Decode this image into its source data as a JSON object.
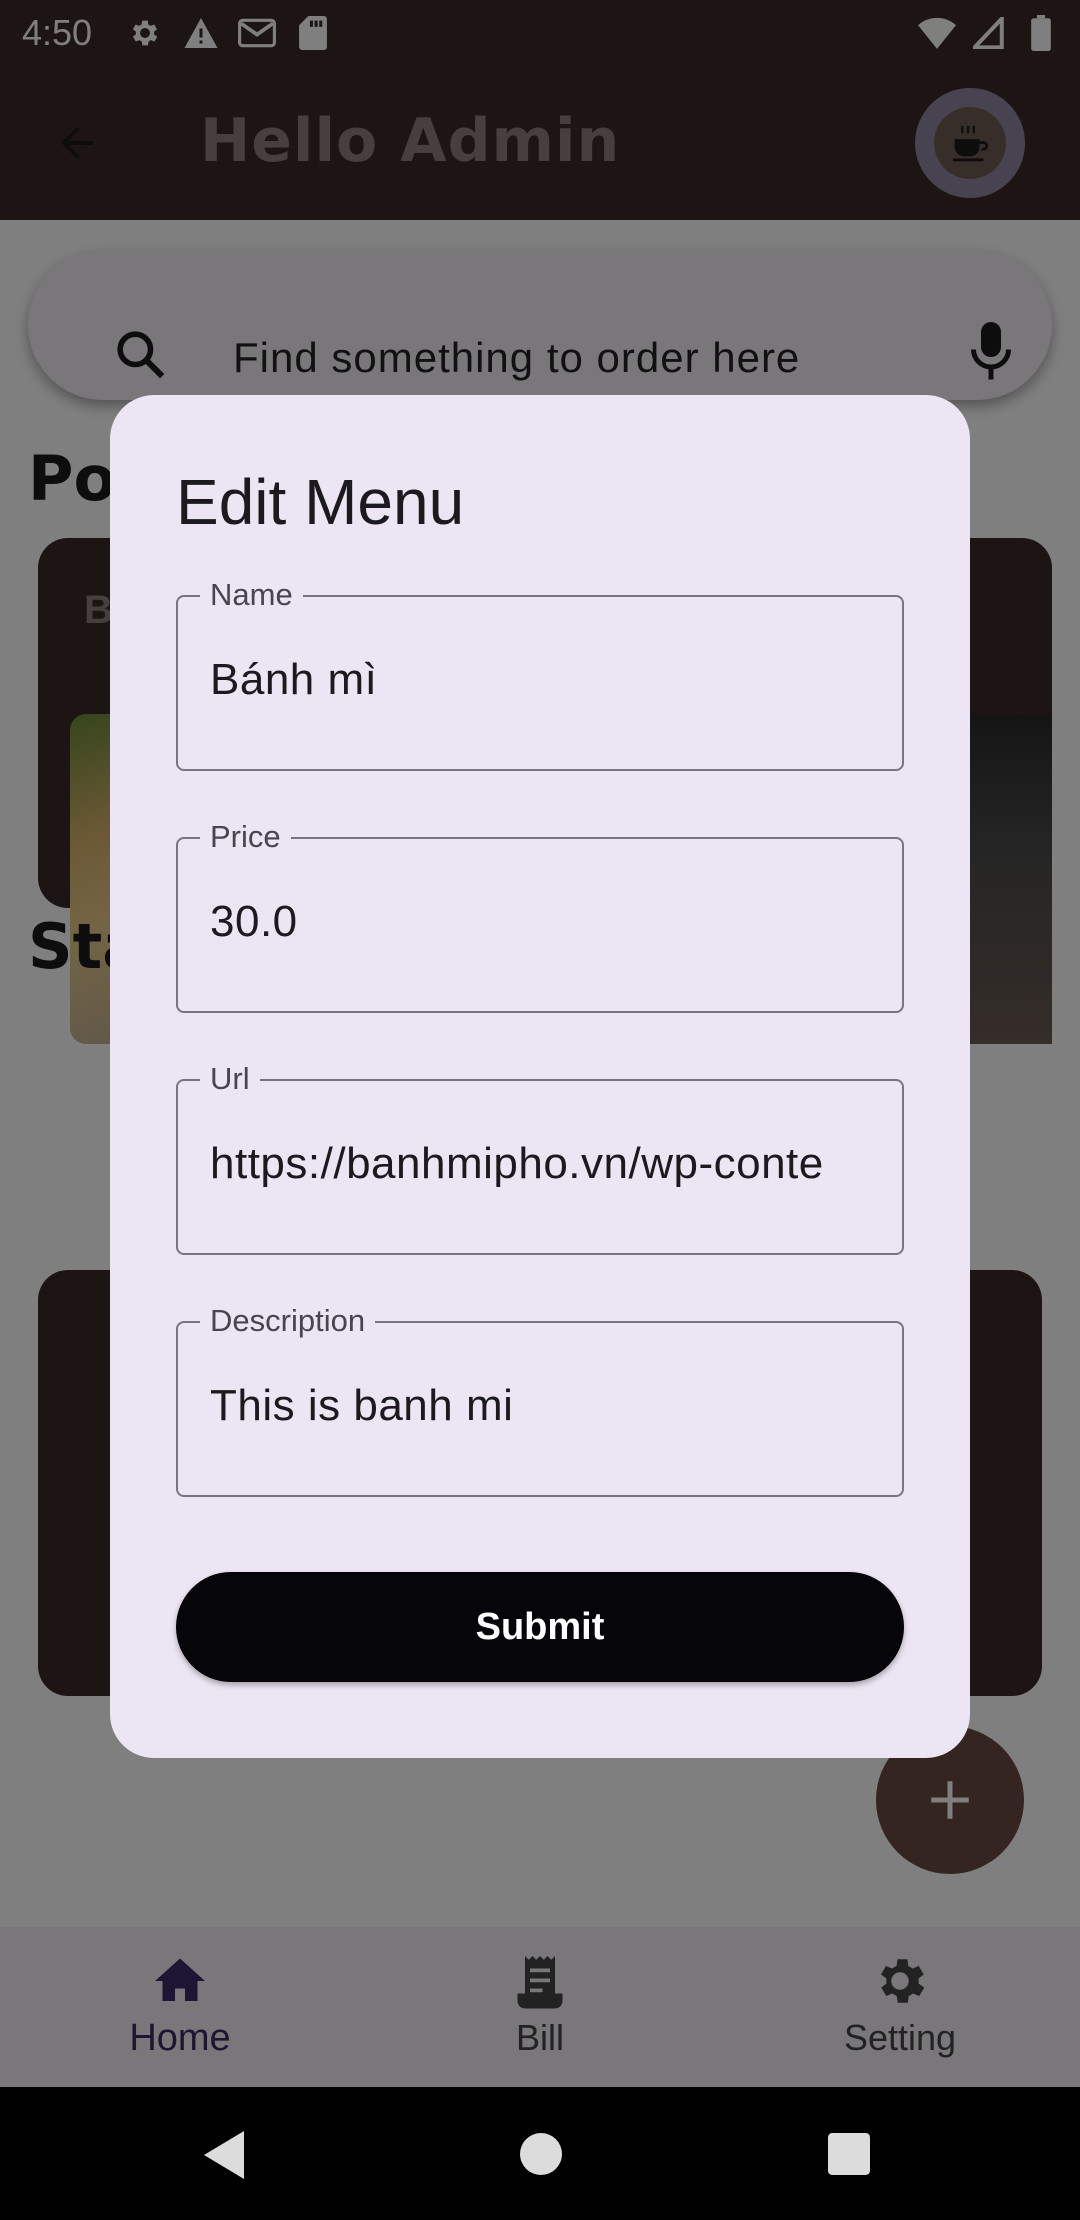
{
  "status_bar": {
    "time": "4:50",
    "left_icons": [
      "gear-icon",
      "warning-icon",
      "gmail-icon",
      "sd-card-icon"
    ],
    "right_icons": [
      "wifi-icon",
      "signal-icon",
      "battery-icon"
    ]
  },
  "app_bar": {
    "title": "Hello Admin",
    "back_icon": "arrow-back-icon",
    "avatar_icon": "coffee-cup-icon"
  },
  "search": {
    "placeholder": "Find something to order here",
    "search_icon": "search-icon",
    "mic_icon": "mic-icon"
  },
  "sections": {
    "popular_title": "Popular",
    "popular_card_label": "B",
    "starred_title": "Starred"
  },
  "dialog": {
    "title": "Edit Menu",
    "fields": [
      {
        "label": "Name",
        "value": "Bánh mì"
      },
      {
        "label": "Price",
        "value": "30.0"
      },
      {
        "label": "Url",
        "value": "https://banhmipho.vn/wp-conte"
      },
      {
        "label": "Description",
        "value": "This is banh mi"
      }
    ],
    "submit_label": "Submit"
  },
  "fab": {
    "icon": "plus-icon"
  },
  "bottom_nav": {
    "items": [
      {
        "label": "Home",
        "icon": "home-icon",
        "active": true
      },
      {
        "label": "Bill",
        "icon": "receipt-icon",
        "active": false
      },
      {
        "label": "Setting",
        "icon": "gear-icon",
        "active": false
      }
    ]
  },
  "colors": {
    "app_bar": "#3a2a26",
    "dialog_bg": "#ece5f3",
    "submit_bg": "#060509",
    "active_nav": "#3a2a66"
  }
}
